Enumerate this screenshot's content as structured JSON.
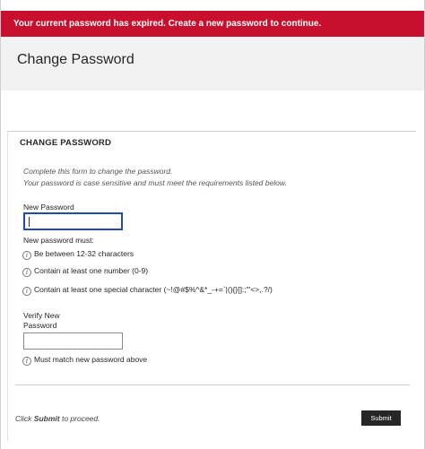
{
  "alert": {
    "text": "Your current password has expired. Create a new password to continue."
  },
  "header": {
    "title": "Change Password"
  },
  "section": {
    "title": "CHANGE PASSWORD",
    "intro_line1": "Complete this form to change the password.",
    "intro_line2": "Your password is case sensitive and must meet the requirements listed below."
  },
  "new_password": {
    "label": "New Password",
    "value": "",
    "requirements_heading": "New password must:",
    "requirements": [
      "Be between 12-32 characters",
      "Contain at least one number (0-9)",
      "Contain at least one special character (~!@#$%^&*_-+=`|(){}[]:;\"'<>,.?/)"
    ]
  },
  "verify_password": {
    "label_line1": "Verify New",
    "label_line2": "Password",
    "value": "",
    "requirement": "Must match new password above"
  },
  "footer": {
    "proceed_prefix": "Click ",
    "proceed_bold": "Submit",
    "proceed_suffix": " to proceed.",
    "submit_label": "Submit"
  },
  "colors": {
    "alert_bg": "#c8102e",
    "focus_border": "#1e4fa3",
    "button_bg": "#262626"
  },
  "icons": {
    "requirement_icon": "info-icon"
  }
}
